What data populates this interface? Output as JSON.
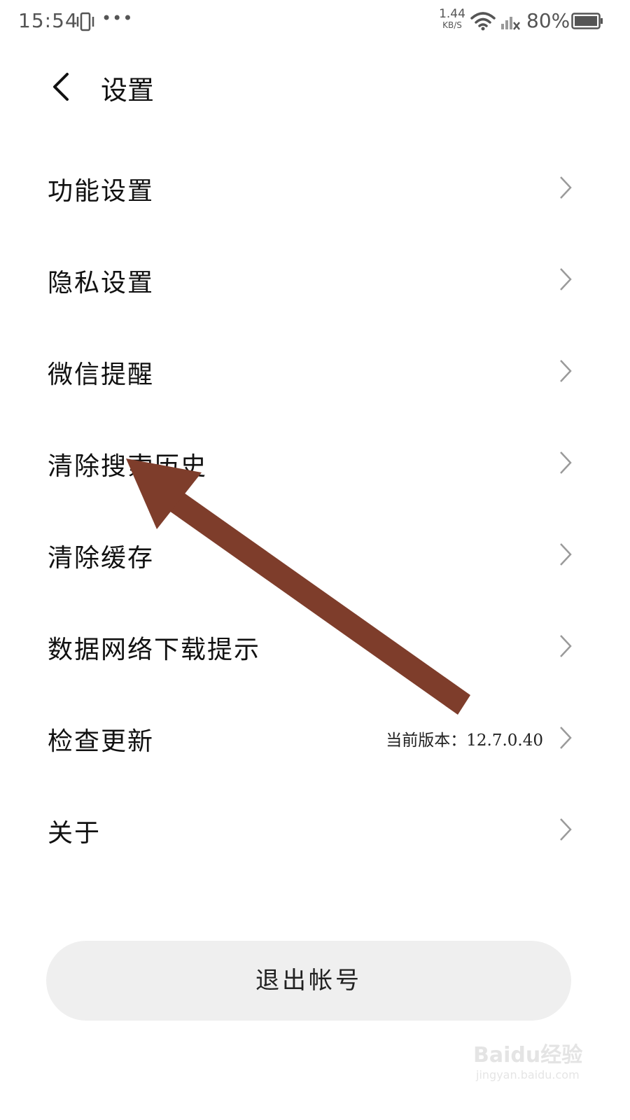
{
  "status_bar": {
    "time": "15:54",
    "more": "•••",
    "net_speed_value": "1.44",
    "net_speed_unit": "KB/S",
    "battery": "80%",
    "icons": [
      "vibrate-icon",
      "wifi-icon",
      "signal-off-icon",
      "battery-icon"
    ]
  },
  "header": {
    "back_icon": "chevron-left-icon",
    "title": "设置"
  },
  "menu": {
    "items": [
      {
        "label": "功能设置"
      },
      {
        "label": "隐私设置"
      },
      {
        "label": "微信提醒"
      },
      {
        "label": "清除搜索历史"
      },
      {
        "label": "清除缓存"
      },
      {
        "label": "数据网络下载提示"
      },
      {
        "label": "检查更新",
        "value": "当前版本：12.7.0.40"
      },
      {
        "label": "关于"
      }
    ]
  },
  "logout": {
    "label": "退出帐号"
  },
  "watermark": {
    "brand": "Baidu经验",
    "url": "jingyan.baidu.com"
  },
  "colors": {
    "arrow": "#7e3d2b",
    "chevron": "#9a9a9a",
    "logout_bg": "#efefef"
  }
}
